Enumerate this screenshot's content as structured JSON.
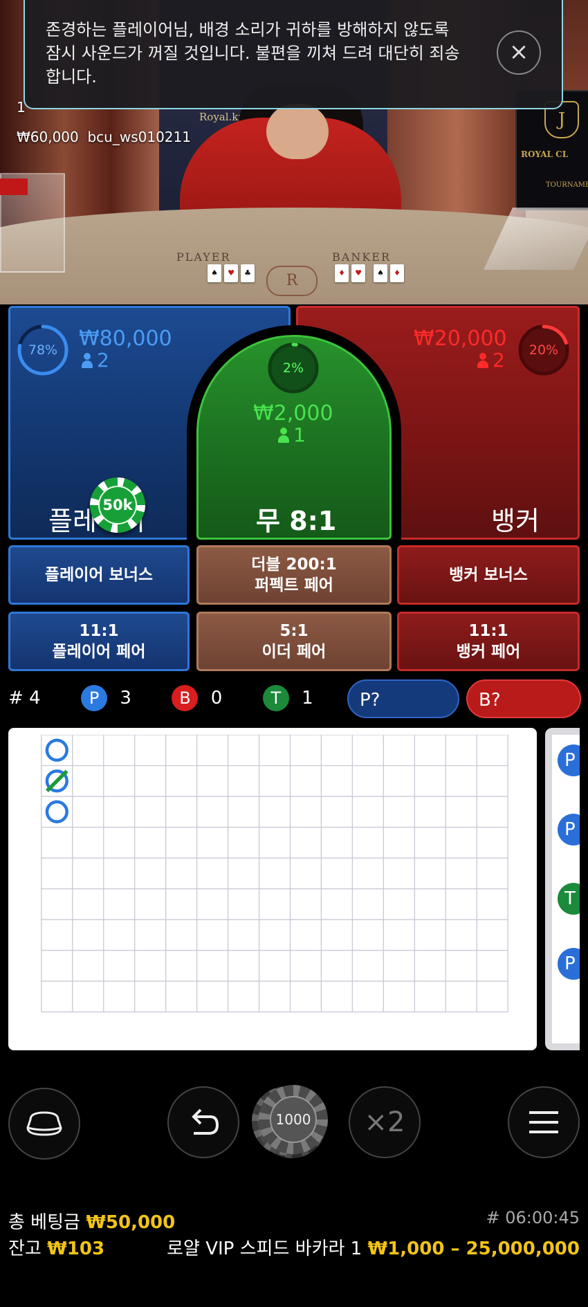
{
  "notice": {
    "text": "존경하는 플레이어님, 배경 소리가 귀하를 방해하지 않도록 잠시 사운드가 꺼질 것입니다. 불편을 끼쳐 드려 대단히 죄송합니다.",
    "close_icon": "×"
  },
  "video": {
    "top_number": "1",
    "min_bet": "₩60,000",
    "table_code": "bcu_ws010211",
    "royal_tag": "Royal.kr",
    "felt_player": "PLAYER",
    "felt_banker": "BANKER",
    "felt_logo": "R",
    "monitor_title": "ROYAL CL",
    "monitor_sub": "TOURNAME",
    "monitor_crest": "J"
  },
  "player_zone": {
    "label": "플레이어",
    "percent": "78%",
    "percent_value": 0.78,
    "amount": "₩80,000",
    "players": "2",
    "chip_value": "50k",
    "color": "#2d7ad6"
  },
  "tie_zone": {
    "label": "무 8:1",
    "percent": "2%",
    "percent_value": 0.02,
    "amount": "₩2,000",
    "players": "1",
    "color": "#3cc43c"
  },
  "banker_zone": {
    "label": "뱅커",
    "percent": "20%",
    "percent_value": 0.2,
    "amount": "₩20,000",
    "players": "2",
    "color": "#c92a2a"
  },
  "side_bets": {
    "player_bonus": "플레이어 보너스",
    "perfect_pair_line1": "더블 200:1",
    "perfect_pair_line2": "퍼펙트 페어",
    "banker_bonus": "뱅커 보너스",
    "player_pair_line1": "11:1",
    "player_pair_line2": "플레이어 페어",
    "either_pair_line1": "5:1",
    "either_pair_line2": "이더 페어",
    "banker_pair_line1": "11:1",
    "banker_pair_line2": "뱅커 페어"
  },
  "stats": {
    "round": "# 4",
    "p_label": "P",
    "p_count": "3",
    "b_label": "B",
    "b_count": "0",
    "t_label": "T",
    "t_count": "1",
    "player_predict": "P?",
    "banker_predict": "B?"
  },
  "roadmap": {
    "results": [
      "P",
      "T",
      "P"
    ],
    "side_marks": [
      "P",
      "P",
      "T",
      "P"
    ]
  },
  "controls": {
    "chip_value": "1000",
    "double_label": "×2"
  },
  "footer": {
    "total_bet_label": "총 베팅금",
    "total_bet_value": "₩50,000",
    "balance_label": "잔고",
    "balance_value": "₩103",
    "game_id": "# 06:00:45",
    "table_name": "로얄 VIP 스피드 바카라 1",
    "limits": "₩1,000 – 25,000,000"
  },
  "colors": {
    "player": "#2d7ad6",
    "banker": "#c92a2a",
    "tie": "#3cc43c",
    "gold": "#f2c416"
  }
}
